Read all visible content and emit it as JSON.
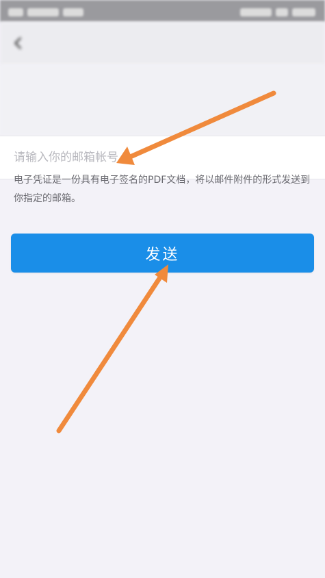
{
  "top_bar": {
    "title": ""
  },
  "info": {
    "line1": "",
    "line2": ""
  },
  "email": {
    "placeholder": "请输入你的邮箱帐号",
    "value": ""
  },
  "description": "电子凭证是一份具有电子签名的PDF文档，将以邮件附件的形式发送到你指定的邮箱。",
  "send_button": {
    "label": "发送"
  },
  "colors": {
    "accent": "#1a8ee8",
    "annotation_arrow": "#f08a3c",
    "page_background": "#f3f2f8"
  }
}
